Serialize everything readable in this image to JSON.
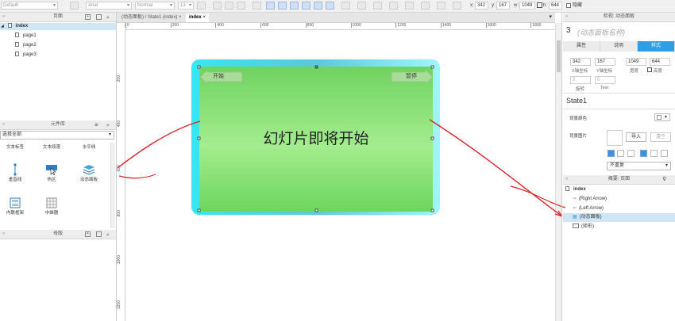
{
  "toolbar": {
    "style_select": "Default",
    "font_select": "Arial",
    "weight_select": "Normal",
    "size_select": "13",
    "x_label": "x:",
    "x_value": "342",
    "y_label": "y:",
    "y_value": "167",
    "w_label": "w:",
    "w_value": "1049",
    "h_label": "h:",
    "h_value": "644",
    "hide_label": "隐藏"
  },
  "pages_panel": {
    "title": "页面",
    "root": "index",
    "pages": [
      "page1",
      "page2",
      "page3"
    ]
  },
  "library_panel": {
    "title": "元件库",
    "filter": "选择全部",
    "widgets": [
      {
        "label": "文本标签"
      },
      {
        "label": "文本段落"
      },
      {
        "label": "水平线"
      },
      {
        "label": "垂直线"
      },
      {
        "label": "热区"
      },
      {
        "label": "动态面板"
      },
      {
        "label": "内联框架"
      },
      {
        "label": "中继器"
      }
    ]
  },
  "master_panel": {
    "title": "母版"
  },
  "canvas": {
    "tabs": [
      "(动态面板) / State1 (index)",
      "index"
    ],
    "ruler_h": [
      "0",
      "200",
      "400",
      "600",
      "800",
      "1000",
      "1200",
      "1400",
      "1600",
      "1800"
    ],
    "ruler_v": [
      "200",
      "400",
      "600",
      "800",
      "1000",
      "1200"
    ],
    "slide_text": "幻灯片即将开始",
    "left_arrow_label": "开始",
    "right_arrow_label": "暂停"
  },
  "inspector": {
    "header": "检视: 动态面板",
    "count": "3",
    "name_placeholder": "(动态面板名称)",
    "tabs": [
      "属性",
      "说明",
      "样式"
    ],
    "x_value": "342",
    "y_value": "167",
    "w_value": "1049",
    "h_value": "644",
    "x_label": "X轴坐标",
    "y_label": "Y轴坐标",
    "w_label": "宽度",
    "h_label": "高度",
    "rotate_value": "0",
    "text_value": "0",
    "rotate_label": "旋转",
    "text_label": "Text",
    "state_name": "State1",
    "bg_color_label": "背景颜色",
    "bg_image_label": "背景图片",
    "import_label": "导入",
    "clear_label": "清空",
    "repeat_value": "不重复"
  },
  "outline": {
    "title": "概要: 页面",
    "root": "index",
    "items": [
      "(Right Arrow)",
      "(Left Arrow)",
      "(动态面板)",
      "(矩形)"
    ]
  },
  "colors": {
    "accent": "#2e9fe6",
    "panel_cyan": "#3de8f0",
    "slide_green": "#7fd870",
    "annotation_red": "#d9252a"
  }
}
